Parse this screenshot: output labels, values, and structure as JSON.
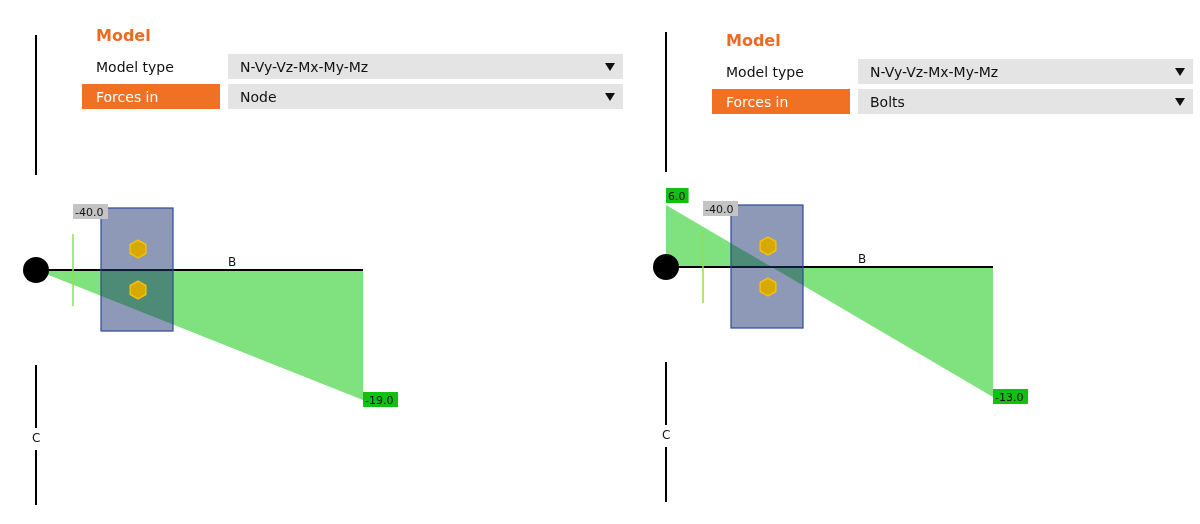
{
  "panels": [
    {
      "title": "Model",
      "rows": [
        {
          "label": "Model type",
          "value": "N-Vy-Vz-Mx-My-Mz",
          "selected": false
        },
        {
          "label": "Forces in",
          "value": "Node",
          "selected": true
        }
      ],
      "diagram": {
        "bolt_value": "-40.0",
        "end_value": "-19.0",
        "beam_label": "B",
        "column_label": "C"
      }
    },
    {
      "title": "Model",
      "rows": [
        {
          "label": "Model type",
          "value": "N-Vy-Vz-Mx-My-Mz",
          "selected": false
        },
        {
          "label": "Forces in",
          "value": "Bolts",
          "selected": true
        }
      ],
      "diagram": {
        "start_value": "6.0",
        "bolt_value": "-40.0",
        "end_value": "-13.0",
        "beam_label": "B",
        "column_label": "C"
      }
    }
  ]
}
